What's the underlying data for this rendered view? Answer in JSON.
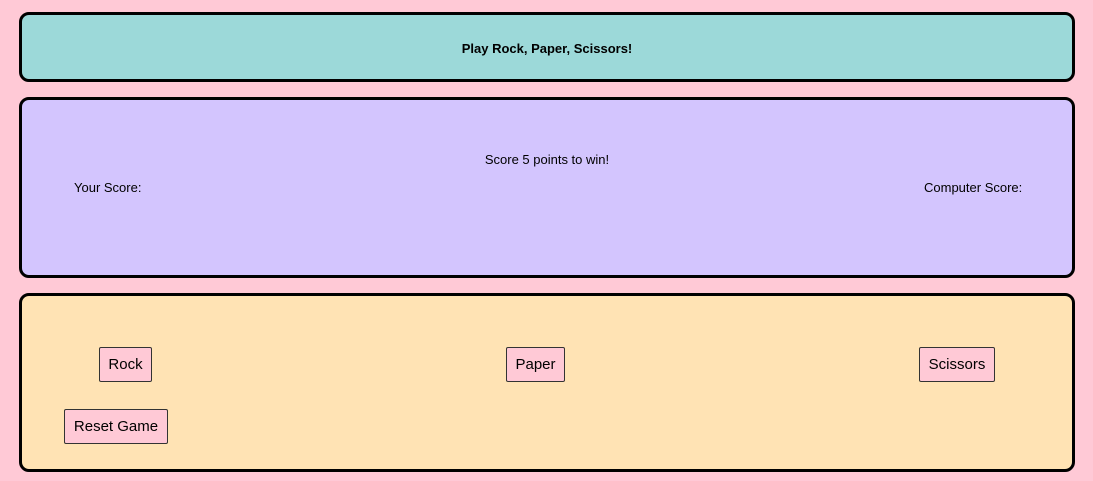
{
  "header": {
    "title": "Play Rock, Paper, Scissors!"
  },
  "scoreboard": {
    "target_text": "Score 5 points to win!",
    "player_score_label": "Your Score:",
    "computer_score_label": "Computer Score:"
  },
  "controls": {
    "rock_label": "Rock",
    "paper_label": "Paper",
    "scissors_label": "Scissors",
    "reset_label": "Reset Game"
  },
  "colors": {
    "page_background": "#ffc9d6",
    "header_panel": "#9cd9d9",
    "score_panel": "#d3c5fe",
    "controls_panel": "#ffe3b4",
    "button_background": "#ffc9d6"
  }
}
